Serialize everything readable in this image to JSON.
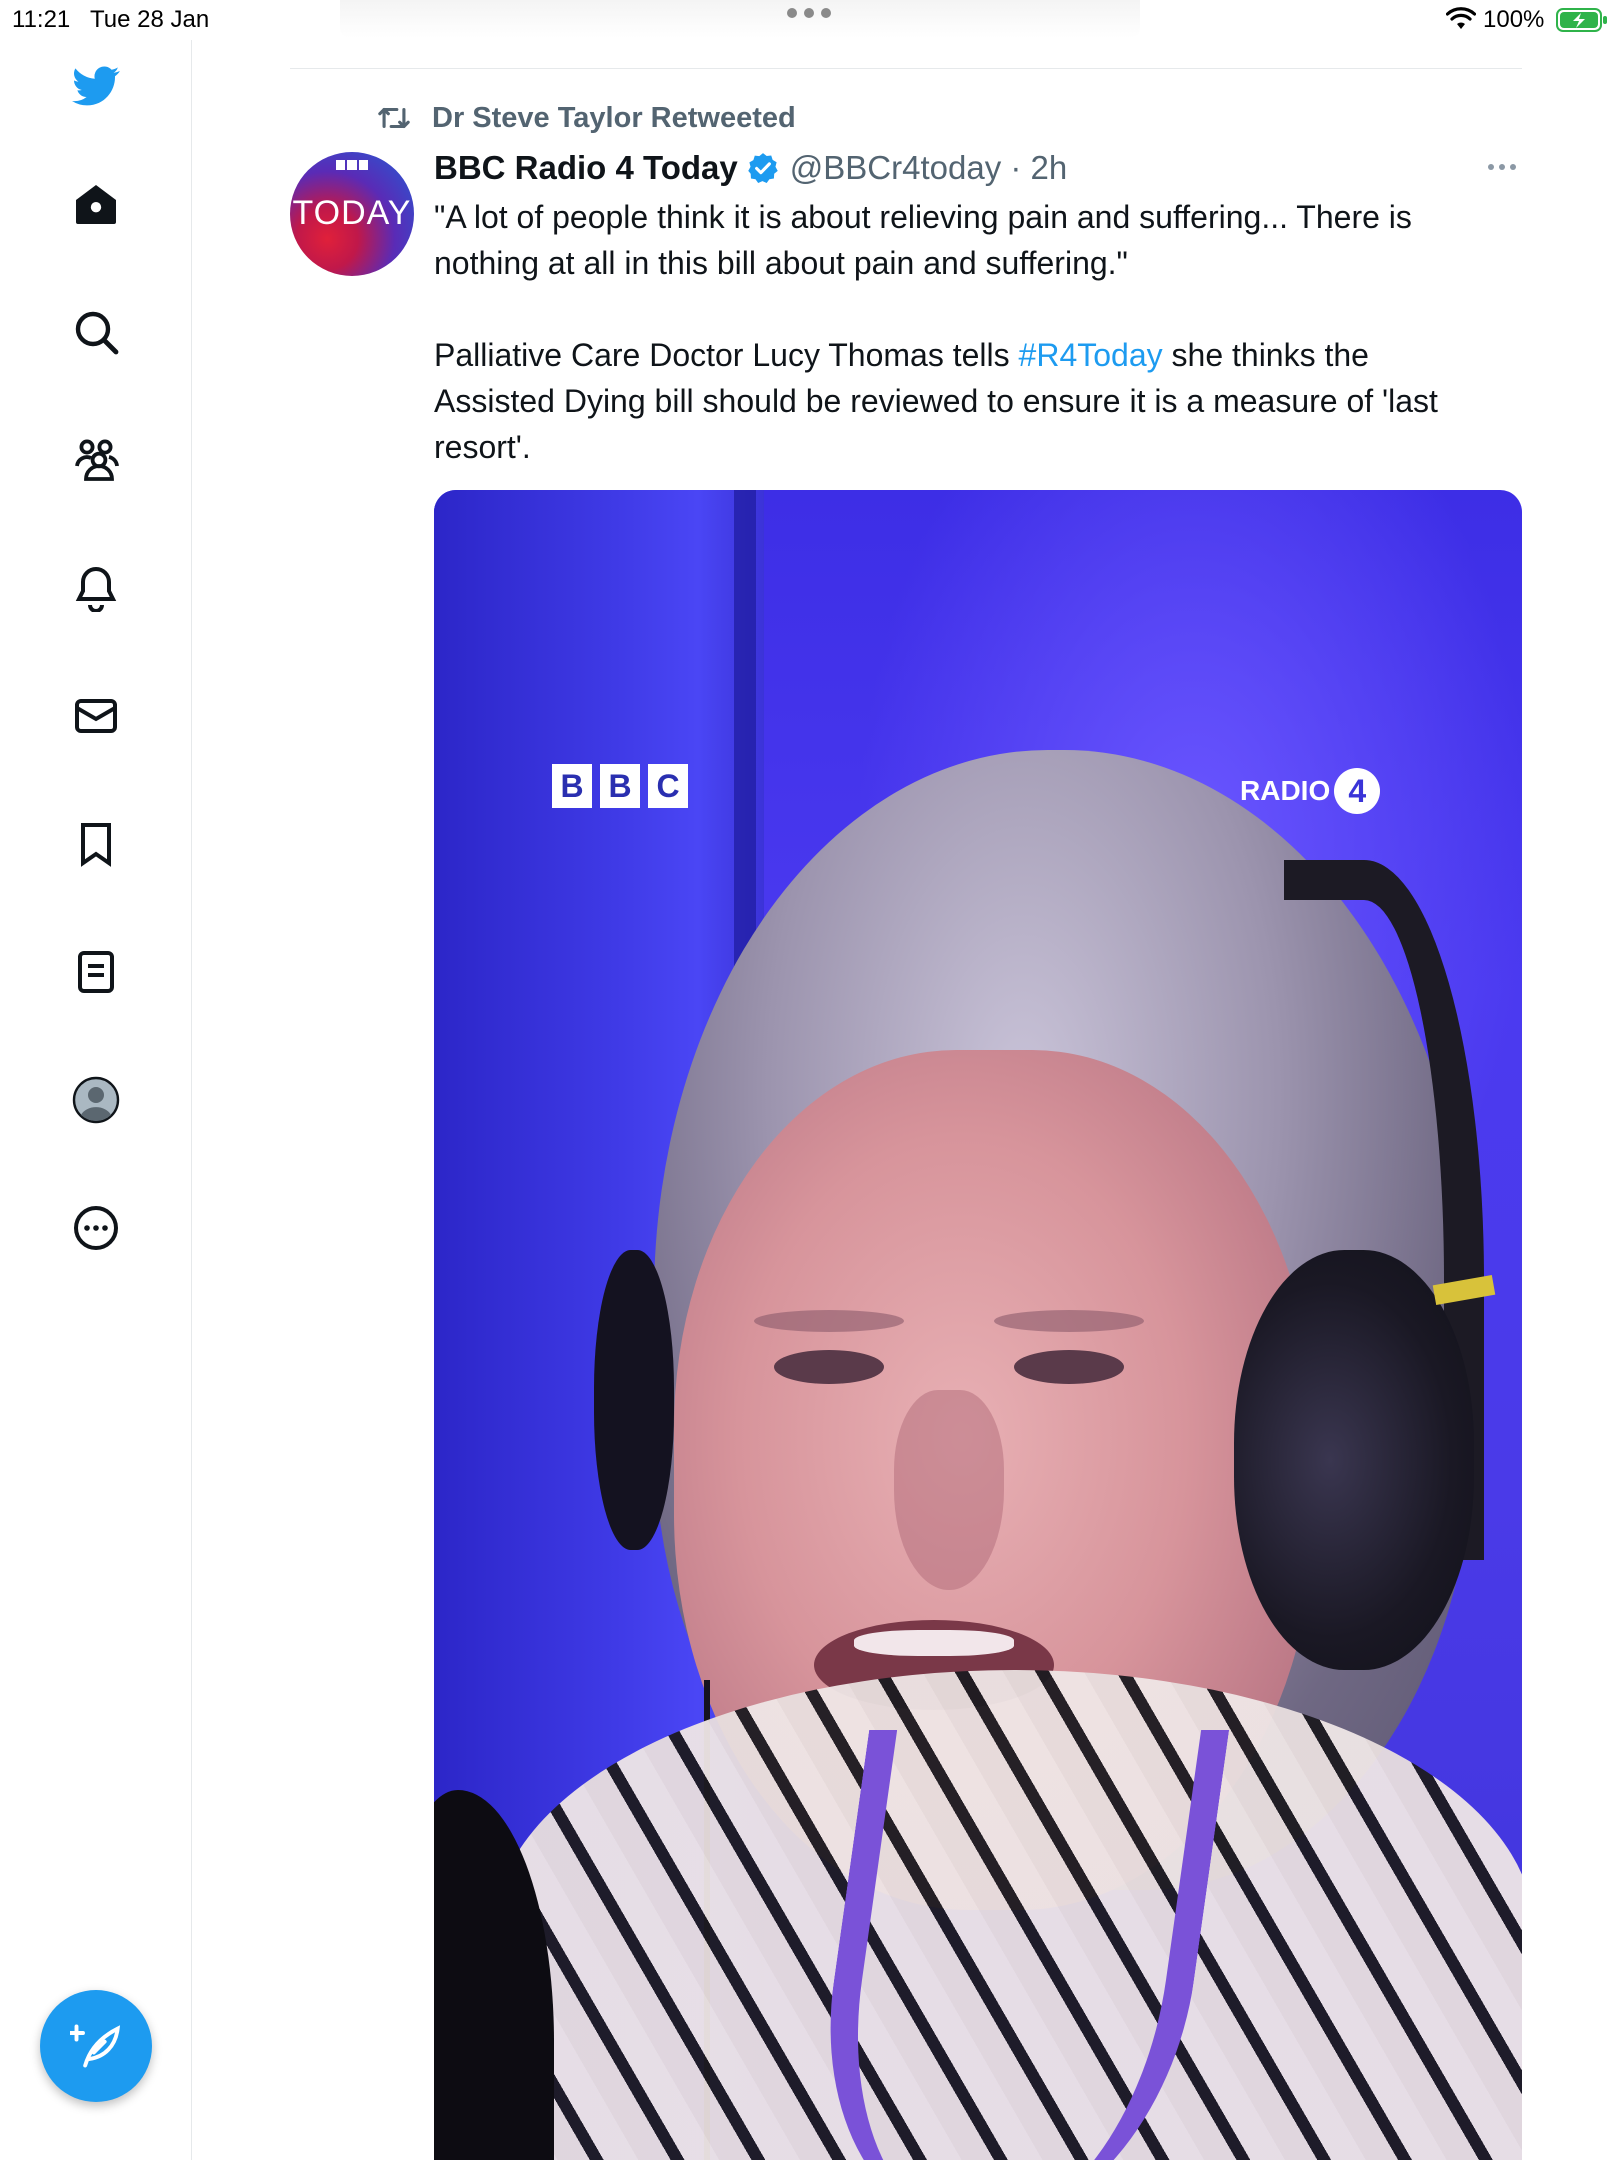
{
  "status_bar": {
    "time": "11:21",
    "date": "Tue 28 Jan",
    "battery": "100%"
  },
  "sidebar": {
    "items": [
      {
        "name": "twitter-logo-icon"
      },
      {
        "name": "home-icon"
      },
      {
        "name": "search-icon"
      },
      {
        "name": "communities-icon"
      },
      {
        "name": "notifications-icon"
      },
      {
        "name": "messages-icon"
      },
      {
        "name": "bookmarks-icon"
      },
      {
        "name": "lists-icon"
      },
      {
        "name": "profile-icon"
      },
      {
        "name": "more-icon"
      }
    ],
    "compose_icon": "compose-tweet-icon"
  },
  "tweet": {
    "retweeted_by": "Dr Steve Taylor Retweeted",
    "avatar_text": "TODAY",
    "display_name": "BBC Radio 4 Today",
    "handle_time": "@BBCr4today · 2h",
    "text_line1": "\"A lot of people think it is about relieving pain and suffering... There is",
    "text_line2": "nothing at all in this bill about pain and suffering.\"",
    "text_p2_a": "Palliative Care Doctor Lucy Thomas tells ",
    "hashtag": "#R4Today",
    "text_p2_b": " she thinks the",
    "text_line4": "Assisted Dying bill should be reviewed to ensure it is a measure of 'last",
    "text_line5": "resort'."
  },
  "media": {
    "bbc_letters": [
      "B",
      "B",
      "C"
    ],
    "radio_label": "RADIO",
    "radio_number": "4"
  },
  "colors": {
    "accent": "#1d9bf0",
    "muted": "#536471",
    "text": "#0f1419"
  }
}
